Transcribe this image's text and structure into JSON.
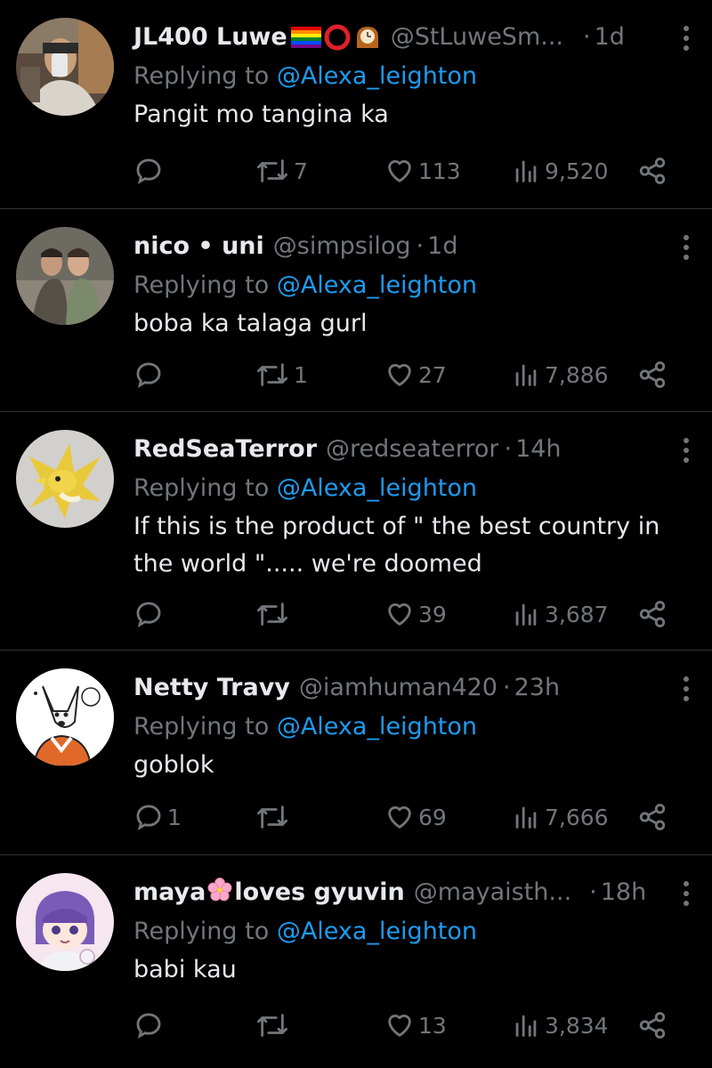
{
  "colors": {
    "background": "#000000",
    "text": "#e7e9ea",
    "muted": "#71767b",
    "accent": "#1d9bf0",
    "divider": "#2f3336"
  },
  "tweets": [
    {
      "name": "JL400 Luwe",
      "name_emoji": [
        "rainbow-flag",
        "hollow-red-circle",
        "mantelpiece-clock"
      ],
      "handle": "@StLuweSm...",
      "time": "1d",
      "reply_prefix": "Replying to",
      "reply_to": "@Alexa_leighton",
      "text": "Pangit mo tangina ka",
      "replies": "",
      "retweets": "7",
      "likes": "113",
      "views": "9,520"
    },
    {
      "name": "nico • uni",
      "handle": "@simpsilog",
      "time": "1d",
      "reply_prefix": "Replying to",
      "reply_to": "@Alexa_leighton",
      "text": "boba ka talaga gurl",
      "replies": "",
      "retweets": "1",
      "likes": "27",
      "views": "7,886"
    },
    {
      "name": "RedSeaTerror",
      "handle": "@redseaterror",
      "time": "14h",
      "reply_prefix": "Replying to",
      "reply_to": "@Alexa_leighton",
      "text_lines": [
        "If this is the product of \" the best country in",
        "the world \"..... we're doomed"
      ],
      "replies": "",
      "retweets": "",
      "likes": "39",
      "views": "3,687"
    },
    {
      "name": "Netty Travy",
      "handle": "@iamhuman420",
      "time": "23h",
      "reply_prefix": "Replying to",
      "reply_to": "@Alexa_leighton",
      "text": "goblok",
      "replies": "1",
      "retweets": "",
      "likes": "69",
      "views": "7,666"
    },
    {
      "name_before": "maya",
      "name_emoji": [
        "cherry-blossom"
      ],
      "name_after": "loves gyuvin",
      "handle": "@mayaisth...",
      "time": "18h",
      "reply_prefix": "Replying to",
      "reply_to": "@Alexa_leighton",
      "text": "babi kau",
      "replies": "",
      "retweets": "",
      "likes": "13",
      "views": "3,834"
    }
  ]
}
